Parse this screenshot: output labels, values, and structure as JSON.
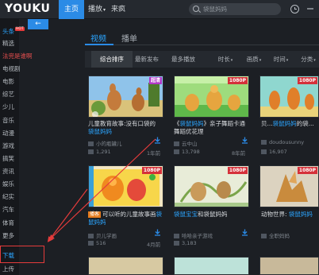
{
  "app": {
    "logo": "YOUKU"
  },
  "top_nav": {
    "tabs": [
      {
        "label": "主页",
        "active": true
      },
      {
        "label": "播放",
        "caret": true
      },
      {
        "label": "来疯"
      }
    ],
    "search_placeholder": "袋鼠妈妈"
  },
  "sidebar": {
    "items": [
      {
        "label": "头条",
        "badge": "HOT",
        "state": "active"
      },
      {
        "label": "精选"
      },
      {
        "label": "法兜是谁啊",
        "state": "red"
      },
      {
        "label": "电视剧"
      },
      {
        "label": "电影"
      },
      {
        "label": "综艺"
      },
      {
        "label": "少儿"
      },
      {
        "label": "音乐"
      },
      {
        "label": "动漫"
      },
      {
        "label": "游戏"
      },
      {
        "label": "搞笑"
      },
      {
        "label": "资讯"
      },
      {
        "label": "娱乐"
      },
      {
        "label": "纪实"
      },
      {
        "label": "汽车"
      },
      {
        "label": "体育"
      },
      {
        "label": "更多"
      },
      {
        "label": "下载",
        "state": "active"
      },
      {
        "label": "上传"
      }
    ]
  },
  "content": {
    "back_label": "←",
    "tabs": [
      {
        "label": "视频",
        "active": true
      },
      {
        "label": "播单"
      }
    ],
    "filters": [
      {
        "label": "综合排序",
        "active": true
      },
      {
        "label": "最新发布"
      },
      {
        "label": "最多播放"
      },
      {
        "label": "时长",
        "caret": true
      },
      {
        "label": "画质",
        "caret": true
      },
      {
        "label": "时间",
        "caret": true
      },
      {
        "label": "分类",
        "caret": true
      }
    ],
    "videos": [
      {
        "badge": "超清",
        "badge_type": "super",
        "title_pre": "儿童教育故事:没有口袋的",
        "title_hl": "袋鼠妈妈",
        "title_post": "",
        "vip": "",
        "uploader": "小的瓶罐儿",
        "plays": "1,291",
        "age": "1年前"
      },
      {
        "badge": "1080P",
        "badge_type": "hd",
        "title_pre": "《",
        "title_hl": "袋鼠妈妈",
        "title_post": "》亲子舞蹈卡通舞蹈优花理",
        "vip": "",
        "uploader": "云中山",
        "plays": "13,798",
        "age": "8年前"
      },
      {
        "badge": "1080P",
        "badge_type": "hd",
        "title_pre": "贝...",
        "title_hl": "袋鼠妈妈",
        "title_post": "的袋...",
        "vip": "",
        "uploader": "doudousunny",
        "plays": "16,907",
        "age": ""
      },
      {
        "badge": "1080P",
        "badge_type": "hd",
        "title_pre": "可以听的儿童故事画",
        "title_hl": "袋鼠妈妈",
        "title_post": "",
        "vip": "播客",
        "uploader": "贝儿学画",
        "plays": "516",
        "age": "4月前"
      },
      {
        "badge": "1080P",
        "badge_type": "hd",
        "title_pre": "",
        "title_hl": "袋鼠宝宝",
        "title_post": "和袋鼠妈妈",
        "vip": "",
        "uploader": "哈哈亲子游戏",
        "plays": "3,183",
        "age": ""
      },
      {
        "badge": "1080P",
        "badge_type": "hd",
        "title_pre": "动物世界: ",
        "title_hl": "袋鼠妈妈",
        "title_post": "",
        "vip": "",
        "uploader": "全职妈妈",
        "plays": "",
        "age": ""
      }
    ]
  },
  "colors": {
    "accent": "#2b8be6",
    "highlight": "#2ba5ff",
    "hd_badge": "#d5313a",
    "annotation": "#e53b3b"
  }
}
